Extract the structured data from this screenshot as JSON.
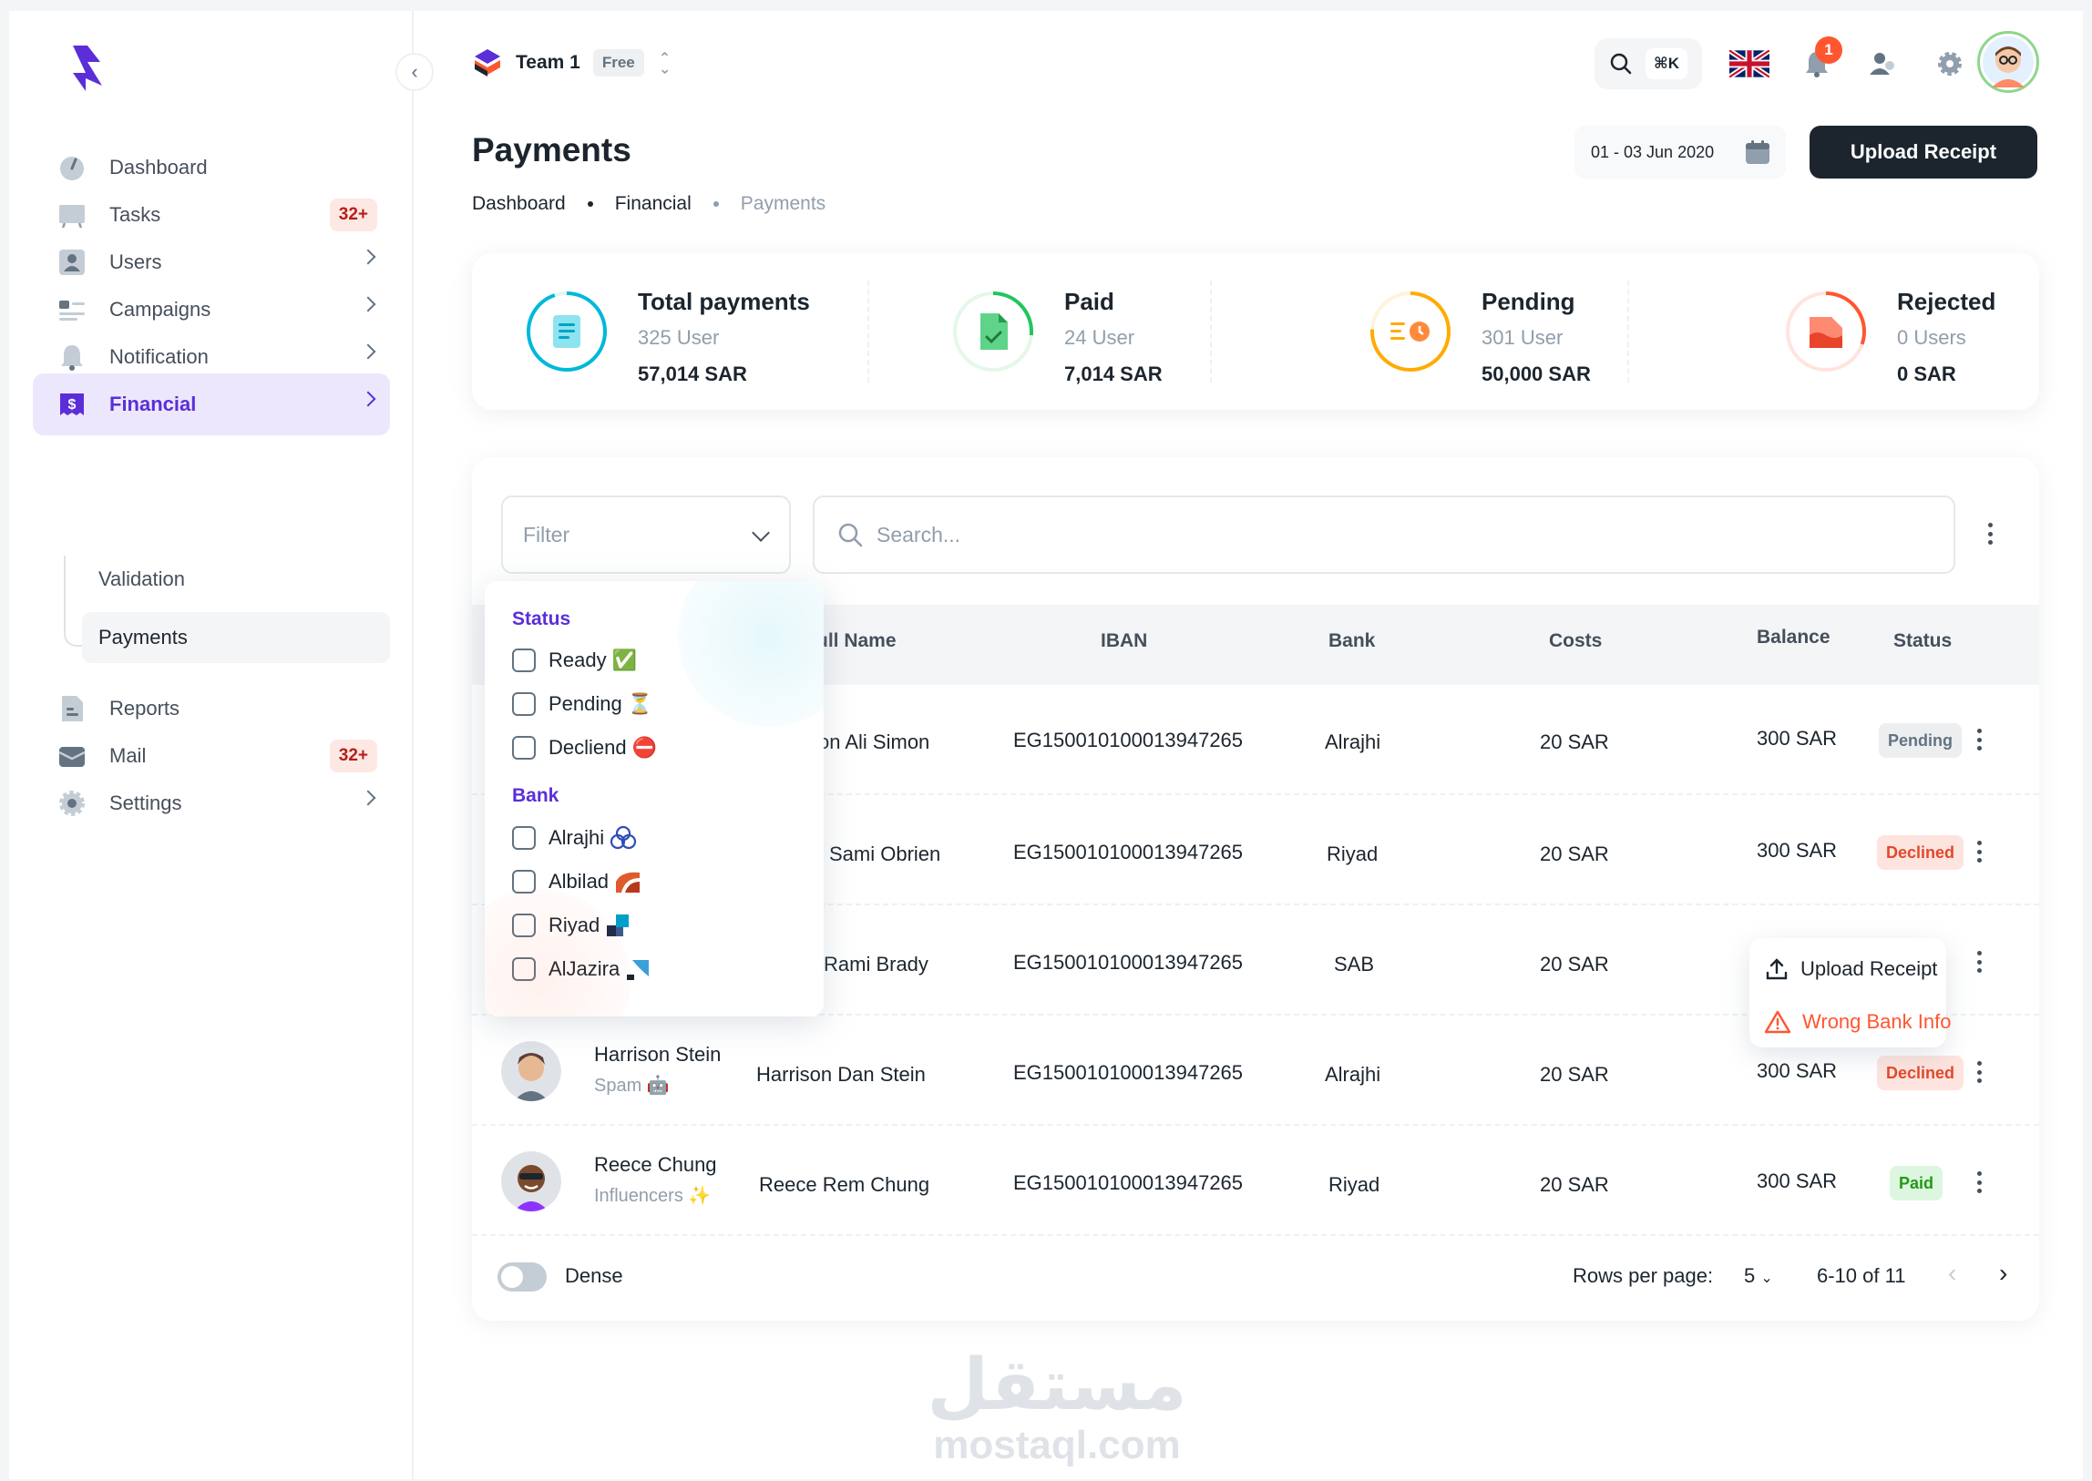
{
  "team": {
    "name": "Team 1",
    "plan": "Free"
  },
  "search_shortcut": "⌘K",
  "notifications_count": "1",
  "sidebar": {
    "items": [
      {
        "label": "Dashboard",
        "icon": "dashboard-icon"
      },
      {
        "label": "Tasks",
        "icon": "tasks-icon",
        "badge": "32+"
      },
      {
        "label": "Users",
        "icon": "users-icon"
      },
      {
        "label": "Campaigns",
        "icon": "campaigns-icon"
      },
      {
        "label": "Notification",
        "icon": "notification-icon"
      },
      {
        "label": "Financial",
        "icon": "financial-icon"
      },
      {
        "label": "Reports",
        "icon": "reports-icon"
      },
      {
        "label": "Mail",
        "icon": "mail-icon",
        "badge": "32+"
      },
      {
        "label": "Settings",
        "icon": "settings-icon"
      }
    ],
    "sub_items": [
      {
        "label": "Validation"
      },
      {
        "label": "Payments"
      }
    ]
  },
  "page": {
    "title": "Payments",
    "breadcrumbs": [
      "Dashboard",
      "Financial",
      "Payments"
    ],
    "date_range": "01 - 03 Jun 2020",
    "upload_label": "Upload Receipt"
  },
  "stats": [
    {
      "label": "Total payments",
      "sub": "325 User",
      "amount": "57,014 SAR",
      "color": "#00b8d9"
    },
    {
      "label": "Paid",
      "sub": "24 User",
      "amount": "7,014 SAR",
      "color": "#22c55e"
    },
    {
      "label": "Pending",
      "sub": "301 User",
      "amount": "50,000 SAR",
      "color": "#ffab00"
    },
    {
      "label": "Rejected",
      "sub": "0 Users",
      "amount": "0 SAR",
      "color": "#ff5630"
    }
  ],
  "table": {
    "filter_placeholder": "Filter",
    "search_placeholder": "Search...",
    "headers": {
      "full_name": "ull Name",
      "iban": "IBAN",
      "bank": "Bank",
      "costs": "Costs",
      "balance": "Balance",
      "status": "Status"
    },
    "rows": [
      {
        "name": "",
        "tag": "",
        "full_name": "on Ali Simon",
        "iban": "EG150010100013947265",
        "bank": "Alrajhi",
        "costs": "20 SAR",
        "balance": "300 SAR",
        "status": "Pending"
      },
      {
        "name": "",
        "tag": "",
        "full_name": "Sami Obrien",
        "iban": "EG150010100013947265",
        "bank": "Riyad",
        "costs": "20 SAR",
        "balance": "300 SAR",
        "status": "Declined"
      },
      {
        "name": "",
        "tag": "",
        "full_name": "Rami Brady",
        "iban": "EG150010100013947265",
        "bank": "SAB",
        "costs": "20 SAR",
        "balance": "",
        "status": ""
      },
      {
        "name": "Harrison Stein",
        "tag": "Spam 🤖",
        "full_name": "Harrison Dan Stein",
        "iban": "EG150010100013947265",
        "bank": "Alrajhi",
        "costs": "20 SAR",
        "balance": "300 SAR",
        "status": "Declined"
      },
      {
        "name": "Reece Chung",
        "tag": "Influencers ✨",
        "full_name": "Reece Rem Chung",
        "iban": "EG150010100013947265",
        "bank": "Riyad",
        "costs": "20 SAR",
        "balance": "300 SAR",
        "status": "Paid"
      }
    ],
    "dense_label": "Dense",
    "rows_per_page_label": "Rows per page:",
    "rows_per_page": "5",
    "page_range": "6-10 of 11"
  },
  "filter_menu": {
    "status_title": "Status",
    "status_options": [
      {
        "label": "Ready",
        "emoji": "✅"
      },
      {
        "label": "Pending",
        "emoji": "⏳"
      },
      {
        "label": "Decliend",
        "emoji": "⛔"
      }
    ],
    "bank_title": "Bank",
    "bank_options": [
      {
        "label": "Alrajhi"
      },
      {
        "label": "Albilad"
      },
      {
        "label": "Riyad"
      },
      {
        "label": "AlJazira"
      }
    ]
  },
  "row_menu": {
    "upload": "Upload Receipt",
    "wrong": "Wrong Bank Info"
  },
  "watermark": {
    "arabic": "مستقل",
    "latin": "mostaql.com"
  }
}
